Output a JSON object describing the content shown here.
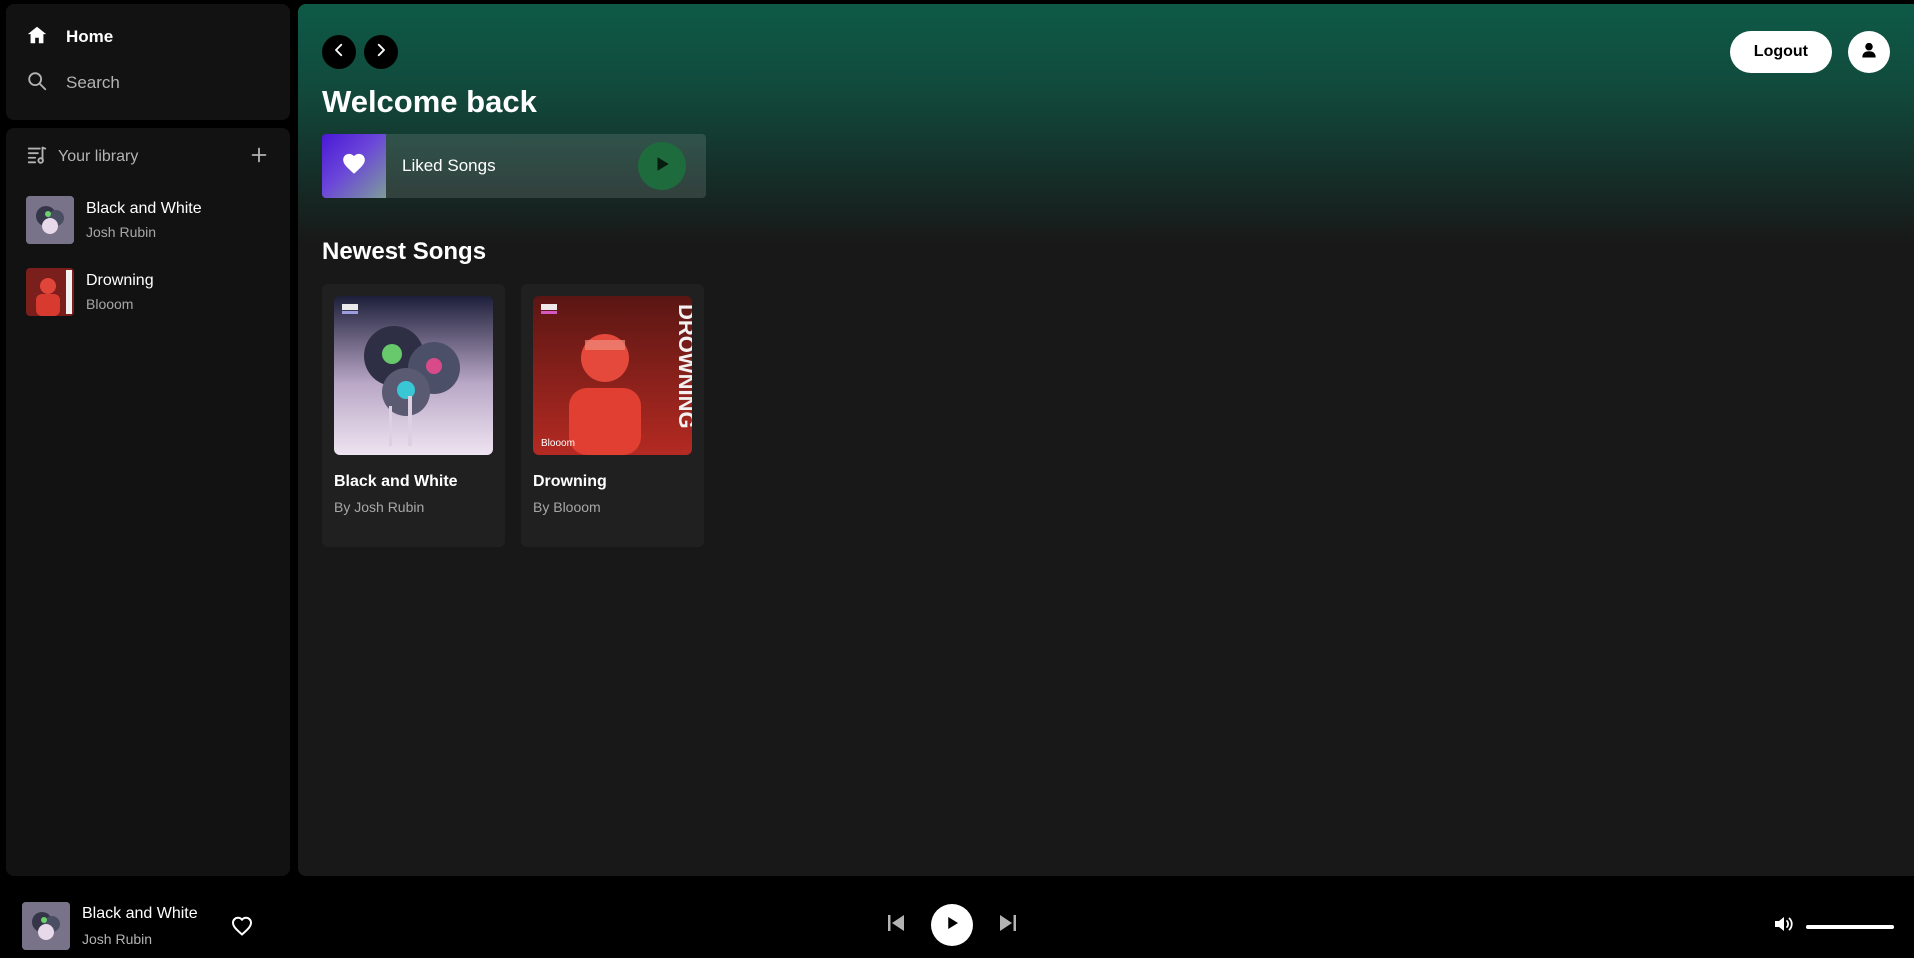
{
  "sidebar": {
    "nav": [
      {
        "label": "Home",
        "icon": "home-icon"
      },
      {
        "label": "Search",
        "icon": "search-icon"
      }
    ],
    "library": {
      "title": "Your library",
      "items": [
        {
          "title": "Black and White",
          "artist": "Josh Rubin"
        },
        {
          "title": "Drowning",
          "artist": "Blooom"
        }
      ]
    }
  },
  "header": {
    "logout_label": "Logout",
    "welcome": "Welcome back"
  },
  "liked": {
    "label": "Liked Songs"
  },
  "newest": {
    "title": "Newest Songs",
    "songs": [
      {
        "title": "Black and White",
        "by": "By Josh Rubin",
        "art_badge": "NCS"
      },
      {
        "title": "Drowning",
        "by": "By Blooom",
        "art_badge": "NCS",
        "art_text": "DROWNING",
        "art_sign": "Blooom"
      }
    ]
  },
  "player": {
    "title": "Black and White",
    "artist": "Josh Rubin",
    "volume": 1.0
  },
  "colors": {
    "accent_green": "#1e6b3d",
    "header_gradient": "#0e5a47",
    "liked_gradient_start": "#4a18d6"
  }
}
